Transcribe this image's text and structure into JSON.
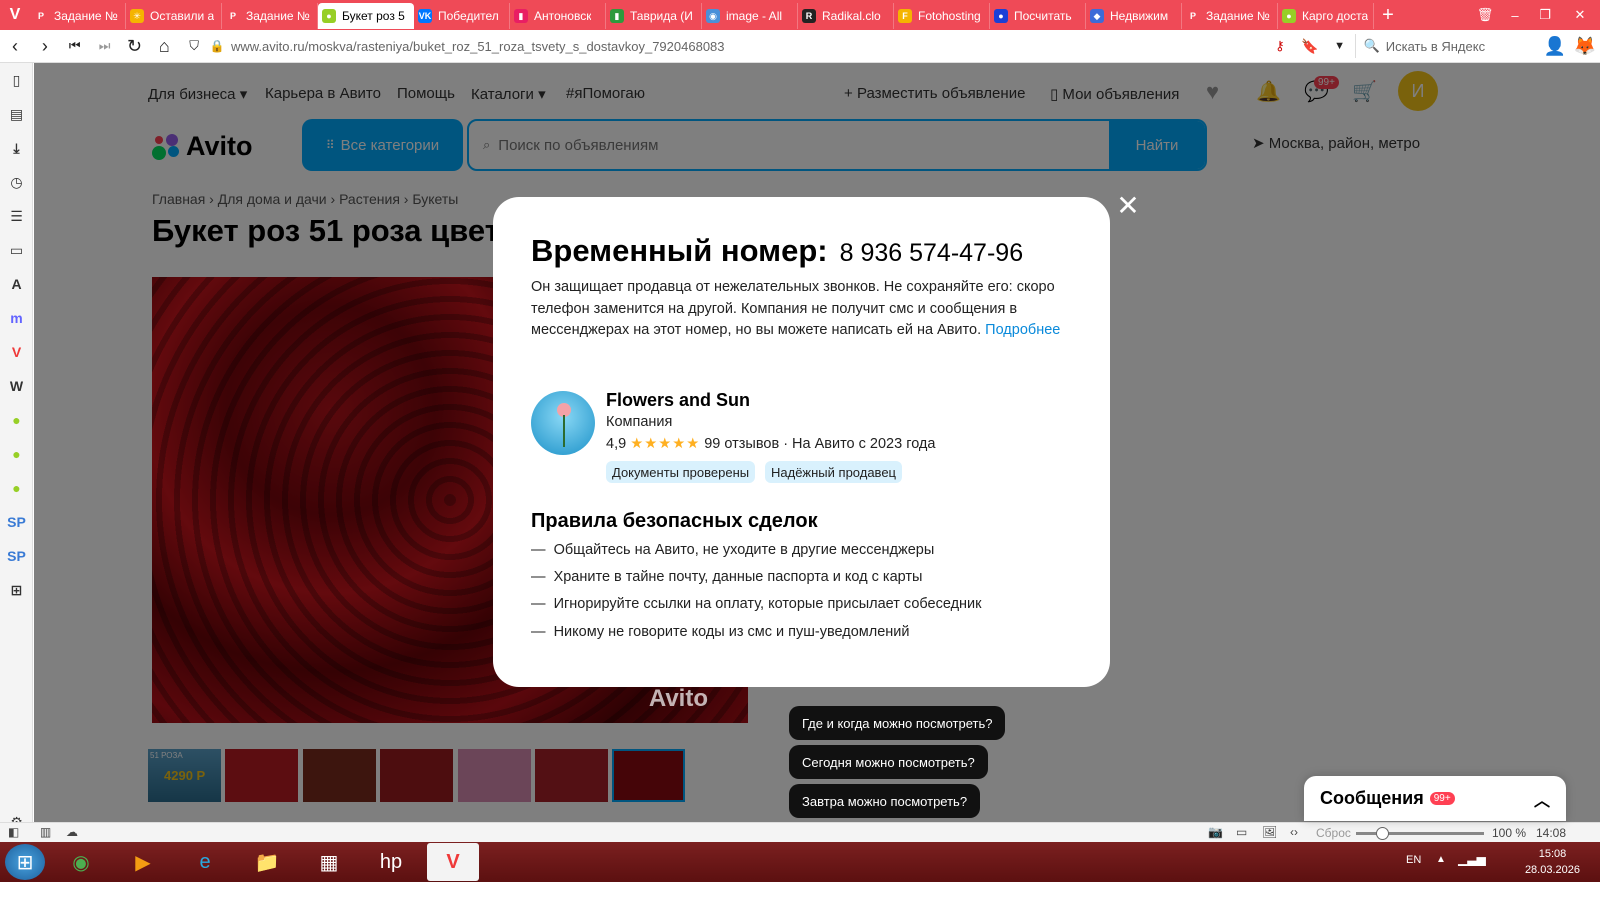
{
  "browser": {
    "tabs": [
      {
        "label": "Задание №",
        "color": "#ef4a57",
        "glyph": "P"
      },
      {
        "label": "Оставили а",
        "color": "#f5b400",
        "glyph": "✳"
      },
      {
        "label": "Задание №",
        "color": "#ef4a57",
        "glyph": "P"
      },
      {
        "label": "Букет роз 5",
        "color": "#97cf26",
        "glyph": "●"
      },
      {
        "label": "Победител",
        "color": "#0077ff",
        "glyph": "VK"
      },
      {
        "label": "Антоновск",
        "color": "#e91e63",
        "glyph": "▮"
      },
      {
        "label": "Таврида (И",
        "color": "#2e9a3c",
        "glyph": "▮"
      },
      {
        "label": "image - All",
        "color": "#4a90d9",
        "glyph": "◉"
      },
      {
        "label": "Radikal.clo",
        "color": "#222222",
        "glyph": "R"
      },
      {
        "label": "Fotohosting",
        "color": "#f5b400",
        "glyph": "F"
      },
      {
        "label": "Посчитать",
        "color": "#1a3fd6",
        "glyph": "●"
      },
      {
        "label": "Недвижим",
        "color": "#3d6bd8",
        "glyph": "◆"
      },
      {
        "label": "Задание №",
        "color": "#ef4a57",
        "glyph": "P"
      },
      {
        "label": "Карго доста",
        "color": "#97cf26",
        "glyph": "●"
      }
    ],
    "active_tab_index": 3,
    "url": "www.avito.ru/moskva/rasteniya/buket_roz_51_roza_tsvety_s_dostavkoy_7920468083",
    "yandex_placeholder": "Искать в Яндекс",
    "zoom": "100 %",
    "zoom_reset": "Сброс",
    "status_time": "14:08"
  },
  "avito": {
    "topnav": [
      "Для бизнеса",
      "Карьера в Авито",
      "Помощь",
      "Каталоги",
      "#яПомогаю"
    ],
    "post_ad": "Разместить объявление",
    "my_ads": "Мои объявления",
    "chat_badge": "99+",
    "avatar_letter": "И",
    "logo": "Avito",
    "categories_btn": "Все категории",
    "search_placeholder": "Поиск по объявлениям",
    "find_btn": "Найти",
    "location": "Москва, район, метро",
    "breadcrumbs": [
      "Главная",
      "Для дома и дачи",
      "Растения",
      "Букеты"
    ],
    "title": "Букет роз 51 роза цвет",
    "watermark": "Avito",
    "thumb_price": "4290 Р",
    "thumb_caption": "51 РОЗА",
    "quick_questions": [
      "Где и когда можно посмотреть?",
      "Сегодня можно посмотреть?",
      "Завтра можно посмотреть?"
    ],
    "messages_label": "Сообщения",
    "messages_badge": "99+"
  },
  "modal": {
    "title": "Временный номер:",
    "phone": "8 936 574-47-96",
    "description": "Он защищает продавца от нежелательных звонков. Не сохраняйте его: скоро телефон заменится на другой. Компания не получит смс и сообщения в мессенджерах на этот номер, но вы можете написать ей на Авито.",
    "more_link": "Подробнее",
    "seller_name": "Flowers and Sun",
    "seller_type": "Компания",
    "rating": "4,9",
    "stars": "★★★★★",
    "reviews": "99 отзывов",
    "since": "· На Авито с 2023 года",
    "badges": [
      "Документы проверены",
      "Надёжный продавец"
    ],
    "rules_title": "Правила безопасных сделок",
    "rules": [
      "Общайтесь на Авито, не уходите в другие мессенджеры",
      "Храните в тайне почту, данные паспорта и код с карты",
      "Игнорируйте ссылки на оплату, которые присылает собеседник",
      "Никому не говорите коды из смс и пуш-уведомлений"
    ],
    "close_icon": "close-icon"
  },
  "taskbar": {
    "lang": "EN",
    "time": "15:08",
    "date": "28.03.2026"
  }
}
